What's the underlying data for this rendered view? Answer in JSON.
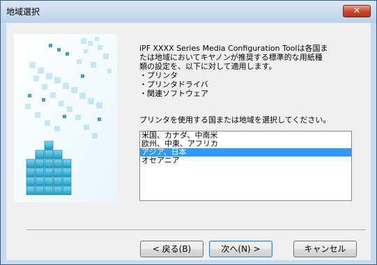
{
  "window": {
    "title": "地域選択",
    "close_symbol": "✕"
  },
  "description": "iPF XXXX  Series Media Configuration Toolは各国ま\nたは地域においてキヤノンが推奨する標準的な用紙種\n類の設定を、以下に対して適用します。\n・プリンタ\n・プリンタドライバ\n・関連ソフトウェア",
  "prompt": "プリンタを使用する国または地域を選択してください。",
  "regions": [
    {
      "label": "米国、カナダ、中南米",
      "selected": false
    },
    {
      "label": "欧州、中東、アフリカ",
      "selected": false
    },
    {
      "label": "アジア、日本",
      "selected": true
    },
    {
      "label": "オセアニア",
      "selected": false
    }
  ],
  "buttons": {
    "back": "< 戻る(B)",
    "next": "次へ(N) >",
    "cancel": "キャンセル"
  },
  "icons": {
    "art": "translucent-cubes-illustration"
  }
}
